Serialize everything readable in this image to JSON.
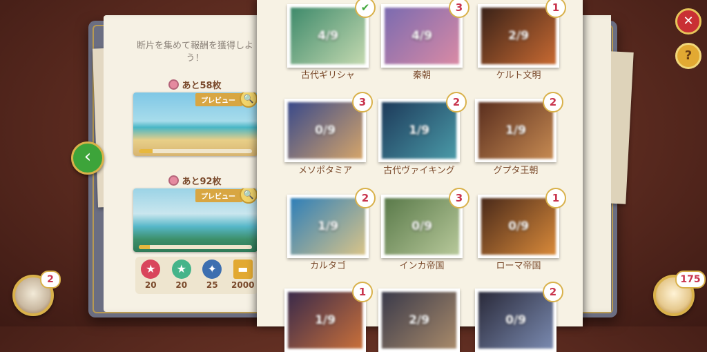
{
  "intro": "断片を集めて報酬を獲得しよう！",
  "puzzles": [
    {
      "remaining": "あと58枚",
      "preview_label": "プレビュー",
      "progress": 0.12
    },
    {
      "remaining": "あと92枚",
      "preview_label": "プレビュー",
      "progress": 0.1
    }
  ],
  "rewards": [
    {
      "icon": "star-badge-icon",
      "value": "20",
      "color": "#d9455c"
    },
    {
      "icon": "green-star-icon",
      "value": "20",
      "color": "#45b48a"
    },
    {
      "icon": "compass-icon",
      "value": "25",
      "color": "#3d6fb0"
    },
    {
      "icon": "gold-bars-icon",
      "value": "2000",
      "color": "#e2a932"
    }
  ],
  "eras": [
    {
      "name": "古代ギリシャ",
      "progress": "4/9",
      "badge": "✔",
      "completed": true,
      "colors": [
        "#3e8a6b",
        "#c4d9b0"
      ]
    },
    {
      "name": "秦朝",
      "progress": "4/9",
      "badge": "3",
      "completed": false,
      "colors": [
        "#7b6bb0",
        "#d98aa5"
      ]
    },
    {
      "name": "ケルト文明",
      "progress": "2/9",
      "badge": "1",
      "completed": false,
      "colors": [
        "#3a2218",
        "#c86a32"
      ]
    },
    {
      "name": "メソポタミア",
      "progress": "0/9",
      "badge": "3",
      "completed": false,
      "colors": [
        "#3a4a8a",
        "#d5a56a"
      ]
    },
    {
      "name": "古代ヴァイキング",
      "progress": "1/9",
      "badge": "2",
      "completed": false,
      "colors": [
        "#1d3a5a",
        "#4a9aa8"
      ]
    },
    {
      "name": "グプタ王朝",
      "progress": "1/9",
      "badge": "2",
      "completed": false,
      "colors": [
        "#5a2e1e",
        "#c68a52"
      ]
    },
    {
      "name": "カルタゴ",
      "progress": "1/9",
      "badge": "2",
      "completed": false,
      "colors": [
        "#2f7fb8",
        "#d9c489"
      ]
    },
    {
      "name": "インカ帝国",
      "progress": "0/9",
      "badge": "3",
      "completed": false,
      "colors": [
        "#5a7a4a",
        "#b7c89a"
      ]
    },
    {
      "name": "ローマ帝国",
      "progress": "0/9",
      "badge": "1",
      "completed": false,
      "colors": [
        "#4a2a1a",
        "#d98a3a"
      ]
    },
    {
      "name": "",
      "progress": "1/9",
      "badge": "1",
      "completed": false,
      "colors": [
        "#3a2a4a",
        "#c9703a"
      ]
    },
    {
      "name": "",
      "progress": "2/9",
      "badge": "",
      "completed": false,
      "colors": [
        "#3a3a4a",
        "#a88a6a"
      ]
    },
    {
      "name": "",
      "progress": "0/9",
      "badge": "2",
      "completed": false,
      "colors": [
        "#2a2a3a",
        "#7a8ab0"
      ]
    }
  ],
  "counters": {
    "left_badge": "2",
    "right_badge": "175"
  },
  "buttons": {
    "close": "✕",
    "help": "?",
    "back": "‹"
  }
}
